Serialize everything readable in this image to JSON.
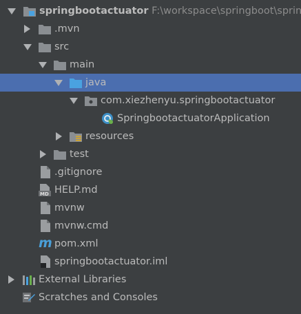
{
  "project": {
    "name": "springbootactuator",
    "path": "F:\\workspace\\springboot\\sprin"
  },
  "tree": {
    "mvn": ".mvn",
    "src": "src",
    "main": "main",
    "java": "java",
    "package": "com.xiezhenyu.springbootactuator",
    "application_class": "SpringbootactuatorApplication",
    "resources": "resources",
    "test": "test",
    "gitignore": ".gitignore",
    "help_md": "HELP.md",
    "mvnw": "mvnw",
    "mvnw_cmd": "mvnw.cmd",
    "pom_xml": "pom.xml",
    "iml": "springbootactuator.iml",
    "external_libraries": "External Libraries",
    "scratches": "Scratches and Consoles"
  },
  "colors": {
    "background": "#3c3f41",
    "selection": "#4b6eaf",
    "text": "#bbbbbb",
    "path_text": "#8c8c8c",
    "folder": "#8a8e92",
    "source_folder": "#4aa2e0",
    "maven": "#4a9fd8"
  },
  "icons": {
    "project_folder": "folder-module-icon",
    "folder": "folder-icon",
    "source_folder": "source-folder-icon",
    "package": "package-icon",
    "spring_class": "spring-boot-class-icon",
    "resources_folder": "resources-folder-icon",
    "file": "text-file-icon",
    "markdown": "markdown-file-icon",
    "maven": "maven-icon",
    "iml": "iml-file-icon",
    "libraries": "libraries-icon",
    "scratches": "scratches-icon"
  }
}
